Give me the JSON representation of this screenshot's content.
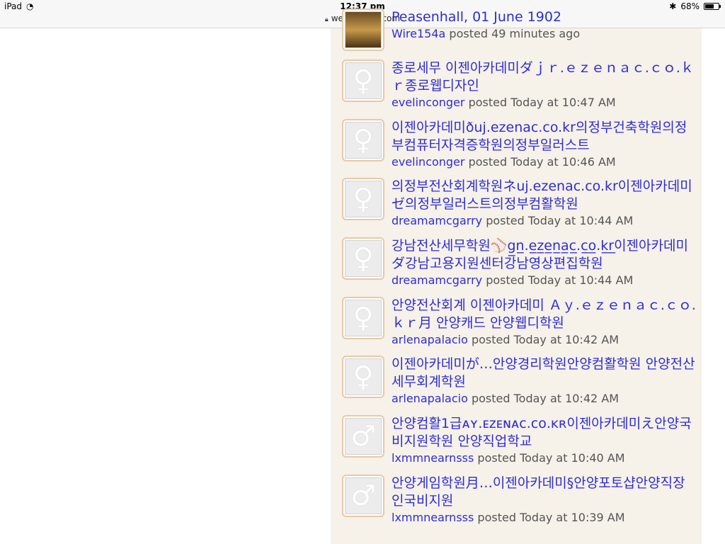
{
  "status_bar": {
    "device": "iPad",
    "time": "12:37 pm",
    "url": "websleuths.com",
    "battery": "68%",
    "battery_level": 0.68,
    "icons": [
      "wifi-icon",
      "lock-icon",
      "bluetooth-icon",
      "battery-icon"
    ]
  },
  "colors": {
    "link": "#2d2dd6",
    "panel_bg": "#f6f1e9",
    "avatar_border": "#e7c9a6"
  },
  "posts": [
    {
      "title": "Peasenhall, 01 June 1902",
      "user": "Wire154a",
      "posted": "posted 49 minutes ago",
      "icon": "thread-thumbnail-icon"
    },
    {
      "title": "종로세무 이젠아카데미ダｊｒ.ｅｚｅｎａｃ.ｃｏ.ｋｒ종로웹디자인",
      "user": "evelinconger",
      "posted": "posted Today at 10:47 AM",
      "icon": "female-symbol-icon"
    },
    {
      "title": "이젠아카데미ðuj.ezenac.co.kr의정부건축학원의정부컴퓨터자격증학원의정부일러스트",
      "user": "evelinconger",
      "posted": "posted Today at 10:46 AM",
      "icon": "female-symbol-icon"
    },
    {
      "title": "의정부전산회계학원ネuj.ezenac.co.kr이젠아카데미ゼ의정부일러스트의정부컴활학원",
      "user": "dreamamcgarry",
      "posted": "posted Today at 10:44 AM",
      "icon": "female-symbol-icon"
    },
    {
      "title": "강남전산세무학원⚾g̲n̲.e̲z̲e̲n̲a̲c̲.c̲o̲.k̲r̲이젠아카데미ダ강남고용지원센터강남영상편집학원",
      "user": "dreamamcgarry",
      "posted": "posted Today at 10:44 AM",
      "icon": "female-symbol-icon"
    },
    {
      "title": "안양전산회계 이젠아카데미 Ａｙ.ｅｚｅｎａｃ.ｃｏ.ｋｒ月 안양캐드 안양웹디학원",
      "user": "arlenapalacio",
      "posted": "posted Today at 10:42 AM",
      "icon": "female-symbol-icon"
    },
    {
      "title": "이젠아카데미が…안양경리학원안양컴활학원 안양전산세무회계학원",
      "user": "arlenapalacio",
      "posted": "posted Today at 10:42 AM",
      "icon": "female-symbol-icon"
    },
    {
      "title": "안양컴활1급ᴀʏ.ᴇᴢᴇɴᴀᴄ.ᴄᴏ.ᴋʀ이젠아카데미え안양국비지원학원 안양직업학교",
      "user": "lxmmnearnsss",
      "posted": "posted Today at 10:40 AM",
      "icon": "male-symbol-icon"
    },
    {
      "title": "안양게임학원月…이젠아카데미§안양포토샵안양직장인국비지원",
      "user": "lxmmnearnsss",
      "posted": "posted Today at 10:39 AM",
      "icon": "male-symbol-icon"
    }
  ]
}
